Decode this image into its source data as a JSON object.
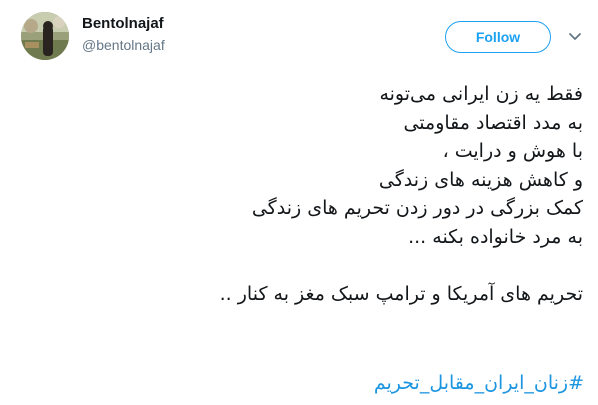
{
  "user": {
    "display_name": "Bentolnajaf",
    "screen_name": "@bentolnajaf"
  },
  "follow_button": {
    "label": "Follow"
  },
  "tweet": {
    "lines": [
      "فقط یه زن ایرانی می‌تونه",
      "به مدد اقتصاد مقاومتی",
      "با هوش و درایت ،",
      "و کاهش هزینه های زندگی",
      "کمک بزرگی در دور زدن تحریم های زندگی",
      "به مرد خانواده بکنه ...",
      "",
      "تحریم های آمریکا و ترامپ سبک مغز به کنار .."
    ],
    "hashtag": "#زنان_ایران_مقابل_تحریم"
  },
  "colors": {
    "accent": "#1da1f2",
    "hashtag": "#1b95e0",
    "text": "#14171a",
    "muted": "#657786"
  },
  "icons": {
    "menu": "chevron-down-icon"
  }
}
